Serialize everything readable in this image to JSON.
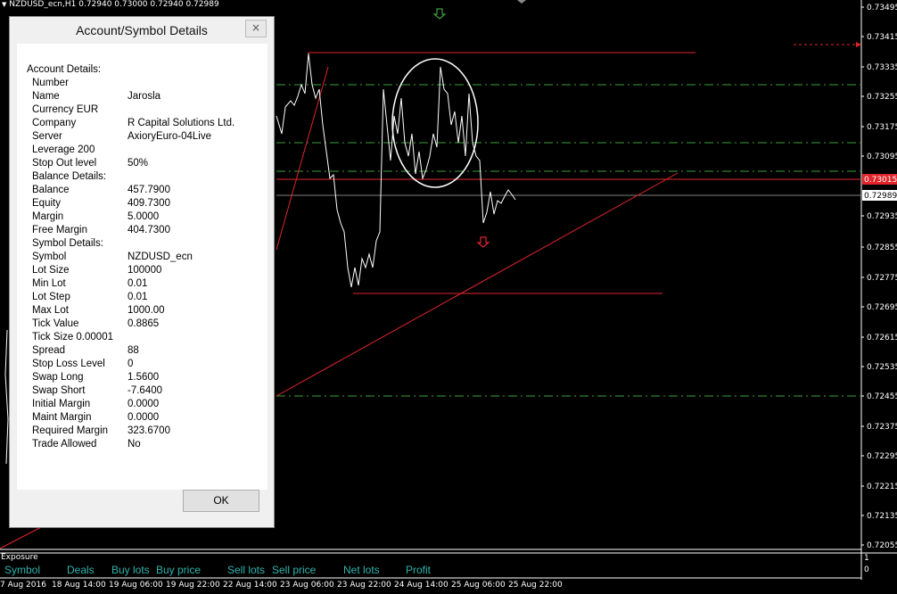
{
  "chart": {
    "title": "NZDUSD_ecn,H1  0.72940 0.73000 0.72940 0.72989",
    "price_axis": [
      "0.73495",
      "0.73415",
      "0.73335",
      "0.73255",
      "0.73175",
      "0.73095",
      "0.72935",
      "0.72855",
      "0.72775",
      "0.72695",
      "0.72615",
      "0.72535",
      "0.72455",
      "0.72375",
      "0.72295",
      "0.72215",
      "0.72135",
      "0.72055"
    ],
    "current_price_label": "0.73015",
    "bid_price_label": "0.72989",
    "time_axis": [
      "7 Aug 2016",
      "18 Aug 14:00",
      "19 Aug 06:00",
      "19 Aug 22:00",
      "22 Aug 14:00",
      "23 Aug 06:00",
      "23 Aug 22:00",
      "24 Aug 14:00",
      "25 Aug 06:00",
      "25 Aug 22:00"
    ],
    "colors": {
      "background": "#000000",
      "price_line": "#ffffff",
      "trend_line": "#e0262b",
      "fib_level": "#3da13a",
      "current_price_box": "#e0262b"
    }
  },
  "dialog": {
    "title": "Account/Symbol Details",
    "close_label": "×",
    "ok_label": "OK",
    "rows": [
      {
        "label": "Account Details:",
        "value": ""
      },
      {
        "label": "Number",
        "value": "",
        "blurred": true
      },
      {
        "label": "Name",
        "value": "Jarosla"
      },
      {
        "label": "Currency EUR",
        "value": ""
      },
      {
        "label": "Company",
        "value": "R Capital Solutions Ltd."
      },
      {
        "label": "Server",
        "value": "AxioryEuro-04Live"
      },
      {
        "label": "Leverage 200",
        "value": ""
      },
      {
        "label": "Stop Out level",
        "value": "50%"
      },
      {
        "label": "Balance Details:",
        "value": ""
      },
      {
        "label": "Balance",
        "value": "457.7900"
      },
      {
        "label": "Equity",
        "value": "409.7300"
      },
      {
        "label": "Margin",
        "value": "5.0000"
      },
      {
        "label": "Free Margin",
        "value": "404.7300"
      },
      {
        "label": "Symbol Details:",
        "value": ""
      },
      {
        "label": "Symbol",
        "value": "NZDUSD_ecn"
      },
      {
        "label": "Lot Size",
        "value": "100000"
      },
      {
        "label": "Min Lot",
        "value": "0.01"
      },
      {
        "label": "Lot Step",
        "value": "0.01"
      },
      {
        "label": "Max Lot",
        "value": "1000.00"
      },
      {
        "label": "Tick Value",
        "value": "0.8865"
      },
      {
        "label": "Tick Size  0.00001",
        "value": ""
      },
      {
        "label": "Spread",
        "value": "88"
      },
      {
        "label": "Stop Loss Level",
        "value": "0"
      },
      {
        "label": "Swap Long",
        "value": "1.5600"
      },
      {
        "label": "Swap Short",
        "value": "-7.6400"
      },
      {
        "label": "Initial Margin",
        "value": "0.0000"
      },
      {
        "label": "Maint Margin",
        "value": "0.0000"
      },
      {
        "label": "Required Margin",
        "value": "323.6700"
      },
      {
        "label": "Trade Allowed",
        "value": "No"
      }
    ]
  },
  "exposure": {
    "title": "Exposure",
    "columns": [
      "Symbol",
      "Deals",
      "Buy lots",
      "Buy price",
      "Sell lots",
      "Sell price",
      "Net lots",
      "Profit"
    ],
    "scale_values": [
      "1",
      "0"
    ]
  }
}
